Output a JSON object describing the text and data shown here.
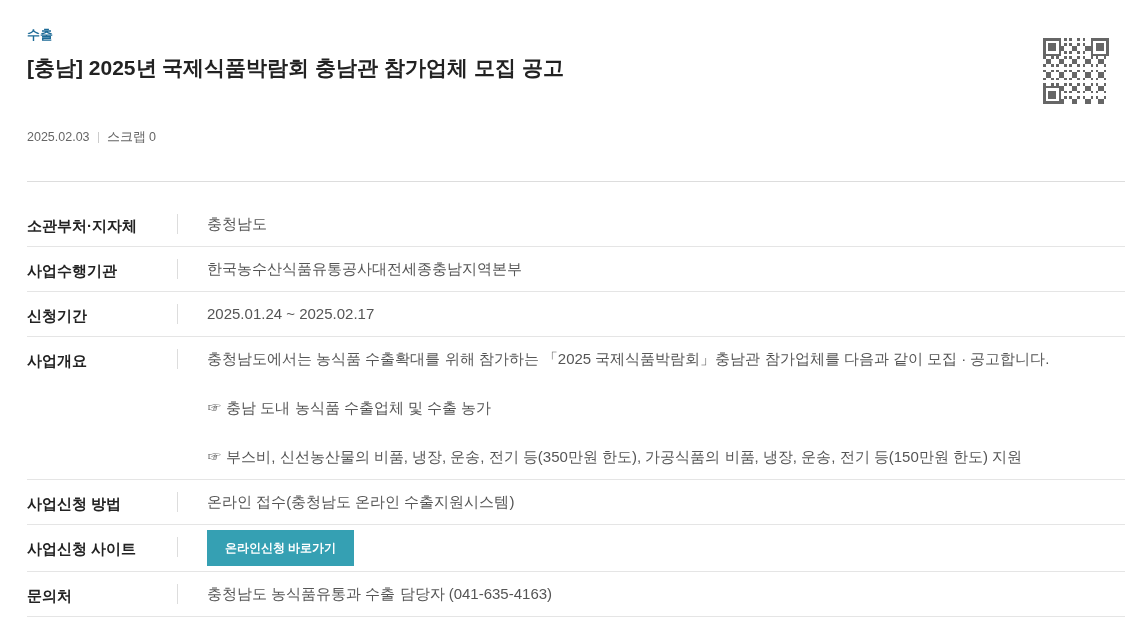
{
  "category": "수출",
  "title": "[충남] 2025년 국제식품박람회 충남관 참가업체 모집 공고",
  "meta": {
    "date": "2025.02.03",
    "scrap": "스크랩 0"
  },
  "rows": [
    {
      "label": "소관부처·지자체",
      "kind": "text",
      "value": "충청남도"
    },
    {
      "label": "사업수행기관",
      "kind": "text",
      "value": "한국농수산식품유통공사대전세종충남지역본부"
    },
    {
      "label": "신청기간",
      "kind": "text",
      "value": "2025.01.24 ~ 2025.02.17"
    },
    {
      "label": "사업개요",
      "kind": "paragraphs",
      "lines": [
        "충청남도에서는 농식품 수출확대를 위해 참가하는 「2025 국제식품박람회」충남관 참가업체를 다음과 같이 모집 · 공고합니다.",
        "☞ 충남 도내 농식품 수출업체 및 수출 농가",
        "☞ 부스비, 신선농산물의 비품, 냉장, 운송, 전기 등(350만원 한도), 가공식품의 비품, 냉장, 운송, 전기 등(150만원 한도) 지원"
      ]
    },
    {
      "label": "사업신청 방법",
      "kind": "text",
      "value": "온라인 접수(충청남도 온라인 수출지원시스템)"
    },
    {
      "label": "사업신청 사이트",
      "kind": "button",
      "value": "온라인신청 바로가기"
    },
    {
      "label": "문의처",
      "kind": "text",
      "value": "충청남도 농식품유통과 수출 담당자 (041-635-4163)"
    }
  ]
}
